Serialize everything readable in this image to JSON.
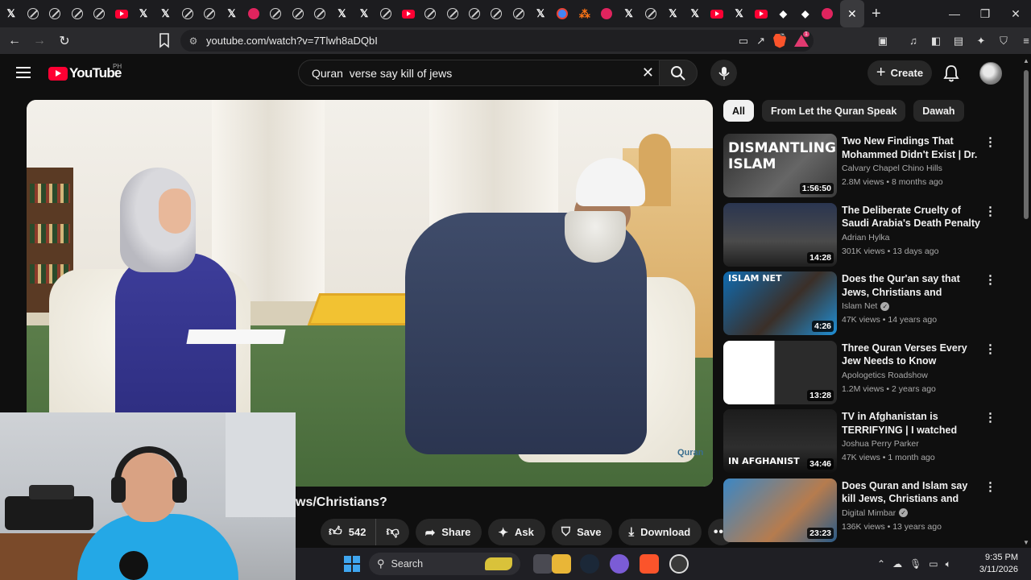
{
  "browser": {
    "tabs": [
      {
        "icon": "x-icon",
        "glyph": "𝕏"
      },
      {
        "icon": "grok-icon",
        "glyph": ""
      },
      {
        "icon": "grok-icon",
        "glyph": ""
      },
      {
        "icon": "grok-icon",
        "glyph": ""
      },
      {
        "icon": "grok-icon",
        "glyph": ""
      },
      {
        "icon": "youtube-icon",
        "glyph": ""
      },
      {
        "icon": "x-icon",
        "glyph": "𝕏"
      },
      {
        "icon": "x-icon",
        "glyph": "𝕏"
      },
      {
        "icon": "grok-icon",
        "glyph": ""
      },
      {
        "icon": "grok-icon",
        "glyph": ""
      },
      {
        "icon": "x-icon",
        "glyph": "𝕏"
      },
      {
        "icon": "pink-circle-icon",
        "glyph": ""
      },
      {
        "icon": "grok-icon",
        "glyph": ""
      },
      {
        "icon": "grok-icon",
        "glyph": ""
      },
      {
        "icon": "grok-icon",
        "glyph": ""
      },
      {
        "icon": "x-icon",
        "glyph": "𝕏"
      },
      {
        "icon": "x-icon",
        "glyph": "𝕏"
      },
      {
        "icon": "grok-icon",
        "glyph": ""
      },
      {
        "icon": "youtube-icon",
        "glyph": ""
      },
      {
        "icon": "grok-icon",
        "glyph": ""
      },
      {
        "icon": "grok-icon",
        "glyph": ""
      },
      {
        "icon": "grok-icon",
        "glyph": ""
      },
      {
        "icon": "grok-icon",
        "glyph": ""
      },
      {
        "icon": "grok-icon",
        "glyph": ""
      },
      {
        "icon": "x-icon",
        "glyph": "𝕏"
      },
      {
        "icon": "google-icon",
        "glyph": ""
      },
      {
        "icon": "dots-icon",
        "glyph": "⁂"
      },
      {
        "icon": "pink-circle-icon",
        "glyph": ""
      },
      {
        "icon": "x-icon",
        "glyph": "𝕏"
      },
      {
        "icon": "grok-icon",
        "glyph": ""
      },
      {
        "icon": "x-icon",
        "glyph": "𝕏"
      },
      {
        "icon": "x-icon",
        "glyph": "𝕏"
      },
      {
        "icon": "youtube-icon",
        "glyph": ""
      },
      {
        "icon": "x-icon",
        "glyph": "𝕏"
      },
      {
        "icon": "youtube-icon",
        "glyph": ""
      },
      {
        "icon": "diamond-icon",
        "glyph": "◆"
      },
      {
        "icon": "diamond-icon",
        "glyph": "◆"
      },
      {
        "icon": "pink-circle-icon",
        "glyph": ""
      }
    ],
    "url": "youtube.com/watch?v=7Tlwh8aDQbI",
    "brave_badge": "64",
    "rewards_badge": "1"
  },
  "youtube": {
    "logo_text": "YouTube",
    "country_code": "PH",
    "search_value": "Quran  verse say kill of jews",
    "create_label": "Create",
    "video_title": "ws/Christians?",
    "actions": {
      "like_count": "542",
      "share_label": "Share",
      "ask_label": "Ask",
      "save_label": "Save",
      "download_label": "Download"
    },
    "player_watermark": "Quran",
    "chips": [
      "All",
      "From Let the Quran Speak",
      "Dawah"
    ],
    "recommendations": [
      {
        "title": "Two New Findings That Mohammed Didn't Exist | Dr. J...",
        "channel": "Calvary Chapel Chino Hills",
        "verified": false,
        "meta": "2.8M views • 8 months ago",
        "duration": "1:56:50",
        "thumb_text": "DISMANTLING ISLAM"
      },
      {
        "title": "The Deliberate Cruelty of Saudi Arabia's Death Penalty",
        "channel": "Adrian Hylka",
        "verified": false,
        "meta": "301K views • 13 days ago",
        "duration": "14:28",
        "thumb_text": ""
      },
      {
        "title": "Does the Qur'an say that Jews, Christians and Sabians will be ...",
        "channel": "Islam Net",
        "verified": true,
        "meta": "47K views • 14 years ago",
        "duration": "4:26",
        "thumb_text": "ISLAM NET"
      },
      {
        "title": "Three Quran Verses Every Jew Needs to Know",
        "channel": "Apologetics Roadshow",
        "verified": false,
        "meta": "1.2M views • 2 years ago",
        "duration": "13:28",
        "thumb_text": ""
      },
      {
        "title": "TV in Afghanistan is TERRIFYING | I watched Afgha...",
        "channel": "Joshua Perry Parker",
        "verified": false,
        "meta": "47K views • 1 month ago",
        "duration": "34:46",
        "thumb_text": "IN AFGHANIST"
      },
      {
        "title": "Does Quran and Islam say kill Jews, Christians and Non ...",
        "channel": "Digital Mimbar",
        "verified": true,
        "meta": "136K views • 13 years ago",
        "duration": "23:23",
        "thumb_text": ""
      }
    ]
  },
  "taskbar": {
    "search_label": "Search",
    "time": "9:35 PM",
    "date": "3/11/2026"
  },
  "colors": {
    "youtube_red": "#ff0033",
    "background": "#0f0f0f",
    "pill": "#272727"
  }
}
